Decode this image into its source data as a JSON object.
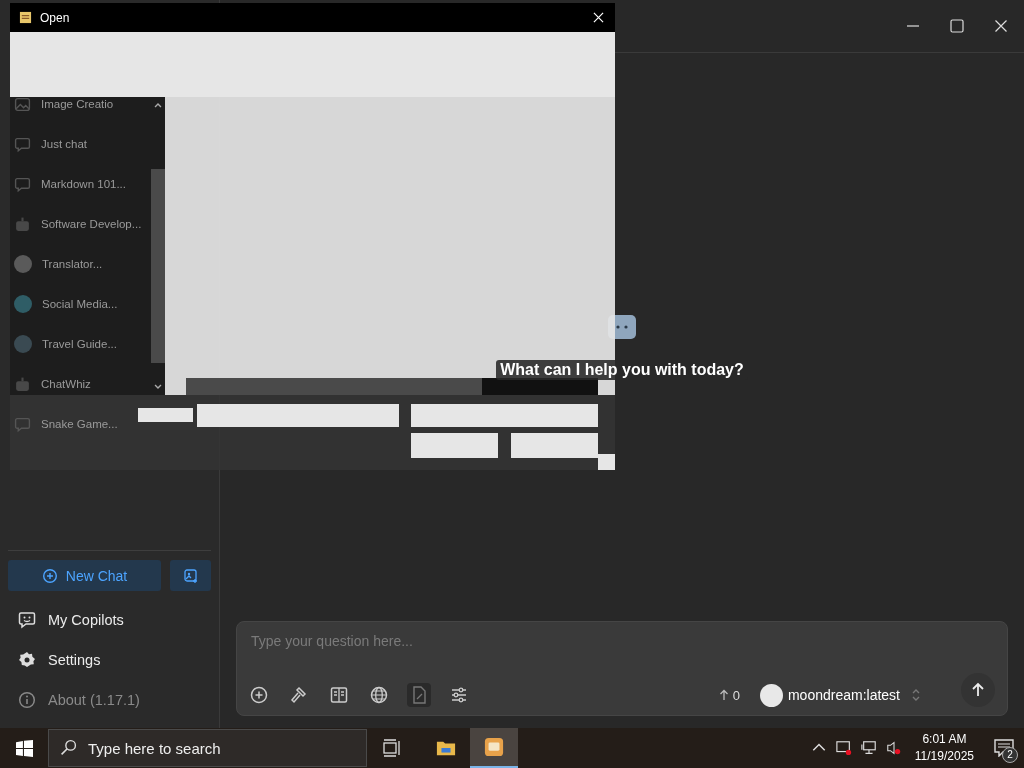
{
  "dialog": {
    "title": "Open"
  },
  "sidebar": {
    "items": [
      {
        "label": "Image Creatio",
        "kind": "image"
      },
      {
        "label": "Just chat",
        "kind": "chat"
      },
      {
        "label": "Markdown 101...",
        "kind": "chat"
      },
      {
        "label": "Software Develop...",
        "kind": "code"
      },
      {
        "label": "Translator...",
        "kind": "avatar",
        "color": "#5a5a5a"
      },
      {
        "label": "Social Media...",
        "kind": "avatar",
        "color": "#2f5d66"
      },
      {
        "label": "Travel Guide...",
        "kind": "avatar",
        "color": "#3a4a52"
      },
      {
        "label": "ChatWhiz",
        "kind": "code"
      },
      {
        "label": "Snake Game...",
        "kind": "chat"
      }
    ],
    "new_chat": "New Chat",
    "menu": [
      {
        "label": "My Copilots",
        "kind": "copilot"
      },
      {
        "label": "Settings",
        "kind": "settings"
      },
      {
        "label": "About (1.17.1)",
        "kind": "about"
      }
    ]
  },
  "main": {
    "greeting": "What can I help you with today?",
    "input": {
      "placeholder": "Type your question here..."
    },
    "token_count": "0",
    "model": "moondream:latest"
  },
  "taskbar": {
    "search": {
      "placeholder": "Type here to search"
    },
    "time": "6:01 AM",
    "date": "11/19/2025",
    "notifications": "2"
  }
}
